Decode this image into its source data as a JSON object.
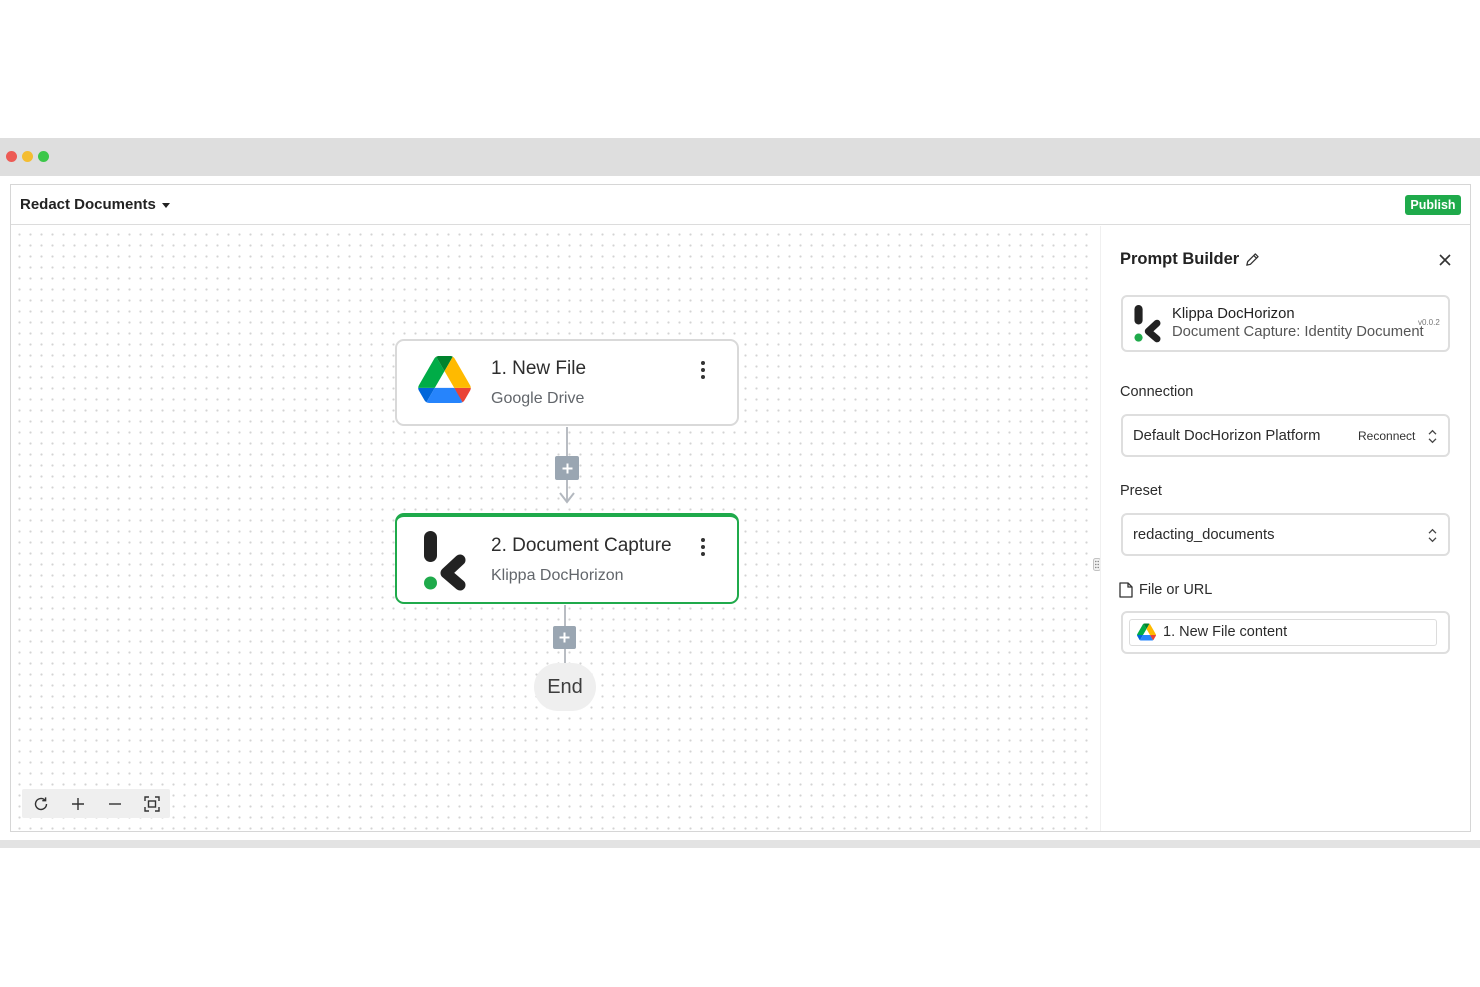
{
  "window": {
    "traffic_light_colors": [
      "#ed5b55",
      "#f4bd31",
      "#3cc74a"
    ]
  },
  "header": {
    "workflow_title": "Redact Documents",
    "publish_label": "Publish"
  },
  "canvas": {
    "nodes": [
      {
        "title": "1. New File",
        "subtitle": "Google Drive",
        "icon": "google-drive-icon",
        "selected": false
      },
      {
        "title": "2. Document Capture",
        "subtitle": "Klippa DocHorizon",
        "icon": "klippa-icon",
        "selected": true
      }
    ],
    "end_label": "End",
    "controls": [
      "refresh-icon",
      "zoom-in-icon",
      "zoom-out-icon",
      "fit-view-icon"
    ]
  },
  "panel": {
    "title": "Prompt Builder",
    "app_card": {
      "name": "Klippa DocHorizon",
      "action": "Document Capture: Identity Document",
      "version": "v0.0.2"
    },
    "connection": {
      "label": "Connection",
      "value": "Default DocHorizon Platform",
      "reconnect_label": "Reconnect"
    },
    "preset": {
      "label": "Preset",
      "value": "redacting_documents"
    },
    "file": {
      "label": "File or URL",
      "chip_icon": "google-drive-icon",
      "chip_text": "1. New File content"
    }
  },
  "colors": {
    "accent_green": "#1faa4b",
    "connector_gray": "#9aa6b2",
    "border_gray": "#dedede"
  }
}
